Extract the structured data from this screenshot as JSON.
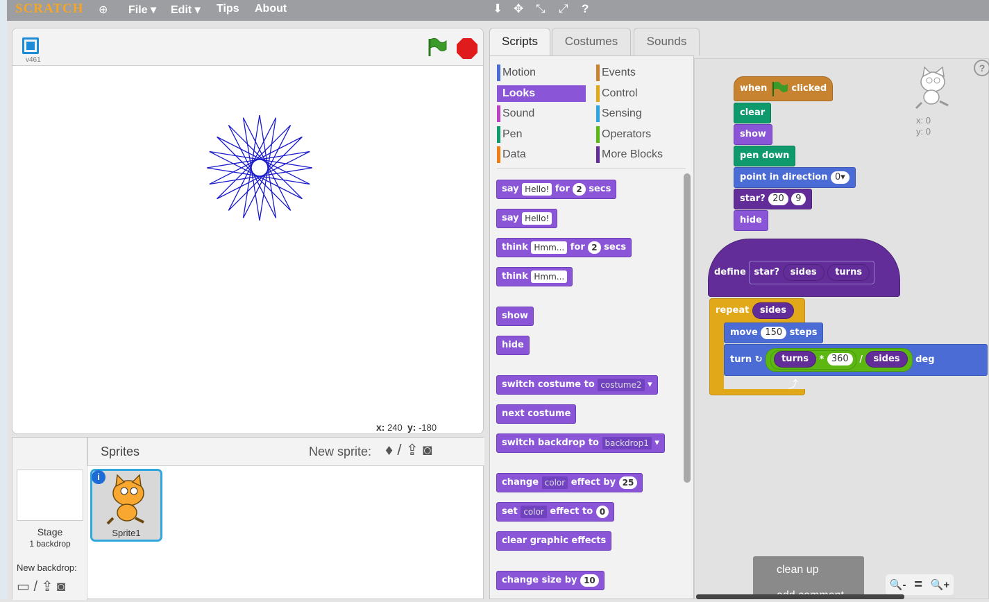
{
  "menubar": {
    "logo": "SCRATCH",
    "globe": "⊕",
    "items": [
      "File ▾",
      "Edit ▾",
      "Tips",
      "About"
    ],
    "tools": [
      "⬇",
      "✥",
      "⤡",
      "⤢",
      "?"
    ]
  },
  "stage": {
    "version": "v461",
    "coords": {
      "x_label": "x:",
      "x_value": "240",
      "y_label": "y:",
      "y_value": "-180"
    },
    "star": {
      "sides": 20,
      "turns": 9,
      "step": 150
    }
  },
  "sprites_panel": {
    "title": "Sprites",
    "new_sprite_label": "New sprite:",
    "stage_label": "Stage",
    "stage_sub": "1 backdrop",
    "new_backdrop_label": "New backdrop:",
    "sprite": {
      "name": "Sprite1",
      "info": "i"
    }
  },
  "tabs": [
    "Scripts",
    "Costumes",
    "Sounds"
  ],
  "categories": {
    "left": [
      {
        "label": "Motion",
        "color": "#4a6cd4"
      },
      {
        "label": "Looks",
        "color": "#8a55d7",
        "active": true
      },
      {
        "label": "Sound",
        "color": "#bb42c3"
      },
      {
        "label": "Pen",
        "color": "#0e9a6c"
      },
      {
        "label": "Data",
        "color": "#ee7d16"
      }
    ],
    "right": [
      {
        "label": "Events",
        "color": "#c88330"
      },
      {
        "label": "Control",
        "color": "#e1a91a"
      },
      {
        "label": "Sensing",
        "color": "#2ca5e2"
      },
      {
        "label": "Operators",
        "color": "#5cb712"
      },
      {
        "label": "More Blocks",
        "color": "#632d99"
      }
    ]
  },
  "palette_blocks": {
    "say_secs": {
      "a": "say",
      "input": "Hello!",
      "b": "for",
      "num": "2",
      "c": "secs"
    },
    "say": {
      "a": "say",
      "input": "Hello!"
    },
    "think_secs": {
      "a": "think",
      "input": "Hmm...",
      "b": "for",
      "num": "2",
      "c": "secs"
    },
    "think": {
      "a": "think",
      "input": "Hmm..."
    },
    "show": "show",
    "hide": "hide",
    "switch_costume": {
      "a": "switch costume to",
      "dd": "costume2"
    },
    "next_costume": "next costume",
    "switch_backdrop": {
      "a": "switch backdrop to",
      "dd": "backdrop1"
    },
    "change_effect": {
      "a": "change",
      "dd": "color",
      "b": "effect by",
      "num": "25"
    },
    "set_effect": {
      "a": "set",
      "dd": "color",
      "b": "effect to",
      "num": "0"
    },
    "clear_effects": "clear graphic effects",
    "change_size": {
      "a": "change size by",
      "num": "10"
    }
  },
  "script": {
    "hat": {
      "a": "when",
      "b": "clicked"
    },
    "clear": "clear",
    "show": "show",
    "pen_down": "pen down",
    "point": {
      "a": "point in direction",
      "num": "0▾"
    },
    "star_call": {
      "a": "star?",
      "n1": "20",
      "n2": "9"
    },
    "hide": "hide",
    "define": {
      "a": "define",
      "name": "star?",
      "p1": "sides",
      "p2": "turns"
    },
    "repeat": {
      "a": "repeat",
      "p": "sides"
    },
    "move": {
      "a": "move",
      "num": "150",
      "b": "steps"
    },
    "turn": {
      "a": "turn ↻",
      "p1": "turns",
      "op1": "*",
      "num": "360",
      "op2": "/",
      "p2": "sides",
      "b": "deg"
    },
    "arrow": "⤴"
  },
  "script_sprite_coords": {
    "x": "x: 0",
    "y": "y: 0"
  },
  "help": "?",
  "context_menu": [
    "clean up",
    "add comment"
  ],
  "zoom": [
    "🔍-",
    "=",
    "🔍+"
  ]
}
